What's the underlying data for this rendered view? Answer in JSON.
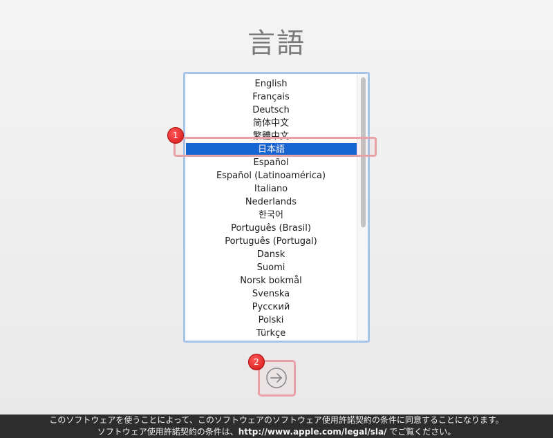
{
  "page": {
    "title": "言語"
  },
  "language_list": {
    "items": [
      "English",
      "Français",
      "Deutsch",
      "简体中文",
      "繁體中文",
      "日本語",
      "Español",
      "Español (Latinoamérica)",
      "Italiano",
      "Nederlands",
      "한국어",
      "Português (Brasil)",
      "Português (Portugal)",
      "Dansk",
      "Suomi",
      "Norsk bokmål",
      "Svenska",
      "Русский",
      "Polski",
      "Türkçe"
    ],
    "selected": "日本語"
  },
  "annotations": {
    "badge_1": "1",
    "badge_2": "2"
  },
  "continue_button": {
    "icon": "arrow-right-circle-icon"
  },
  "footer": {
    "line1": "このソフトウェアを使うことによって、このソフトウェアのソフトウェア使用許諾契約の条件に同意することになります。",
    "line2_prefix": "ソフトウェア使用許諾契約の条件は、",
    "line2_link": "http://www.apple.com/legal/sla/",
    "line2_suffix": " でご覧ください。"
  },
  "colors": {
    "selection": "#0a64d6",
    "badge": "#d41313",
    "highlight": "#e8a1a6",
    "list_border": "#a6c3e8"
  }
}
